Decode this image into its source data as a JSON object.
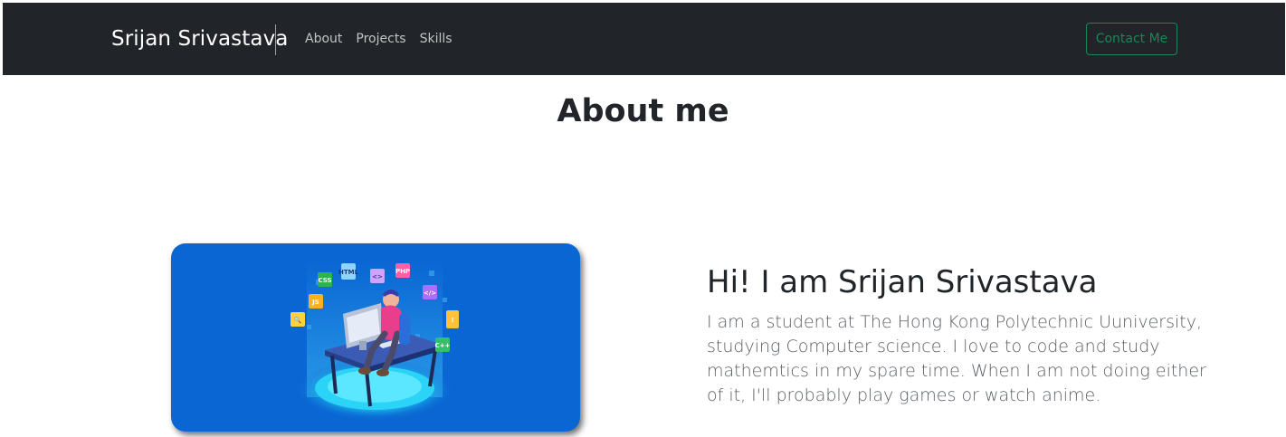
{
  "navbar": {
    "brand": "Srijan Srivastava",
    "links": [
      {
        "label": "About"
      },
      {
        "label": "Projects"
      },
      {
        "label": "Skills"
      }
    ],
    "contact_label": "Contact Me",
    "background": "#212529",
    "accent": "#198754"
  },
  "about": {
    "title": "About me",
    "heading": "Hi! I am Srijan Srivastava",
    "paragraph": "I am a student at The Hong Kong Polytechnic Uuniversity, studying Computer science. I love to code and study mathemtics in my spare time. When I am not doing either of it, I'll probably play games or watch anime.",
    "illustration": {
      "icon": "developer-illustration-icon",
      "background": "#0a66d3",
      "badges": [
        "CSS",
        "HTML",
        "JS",
        "PHP",
        "C++",
        "</>"
      ]
    }
  }
}
